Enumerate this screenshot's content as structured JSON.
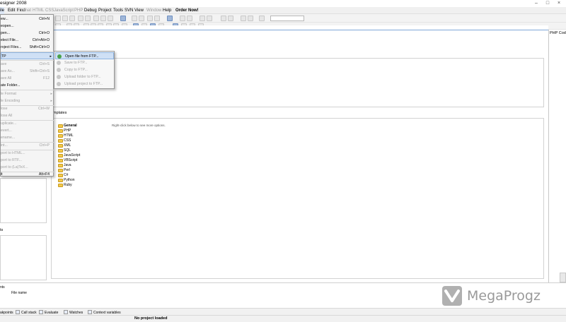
{
  "window": {
    "title": "esigner 2008",
    "controls": [
      "–",
      "□",
      "×"
    ]
  },
  "menubar": {
    "items": [
      {
        "label": "ile",
        "state": "active"
      },
      {
        "label": "Edit",
        "state": "normal"
      },
      {
        "label": "Find",
        "state": "normal"
      },
      {
        "label": "Format",
        "state": "disabled"
      },
      {
        "label": "HTML",
        "state": "disabled"
      },
      {
        "label": "CSS",
        "state": "disabled"
      },
      {
        "label": "JavaScript",
        "state": "disabled"
      },
      {
        "label": "PHP",
        "state": "disabled"
      },
      {
        "label": "Debug",
        "state": "normal"
      },
      {
        "label": "Project",
        "state": "normal"
      },
      {
        "label": "Tools",
        "state": "normal"
      },
      {
        "label": "SVN",
        "state": "normal"
      },
      {
        "label": "View",
        "state": "normal"
      },
      {
        "label": "Window",
        "state": "disabled"
      },
      {
        "label": "Help",
        "state": "normal"
      },
      {
        "label": "Order Now!",
        "state": "bold"
      }
    ]
  },
  "file_menu": {
    "items": [
      {
        "label": "ew...",
        "shortcut": "Ctrl+N",
        "disabled": false
      },
      {
        "label": "eopen...",
        "shortcut": "",
        "disabled": false
      },
      {
        "label": "pen...",
        "shortcut": "Ctrl+O",
        "disabled": false
      },
      {
        "label": "elect File...",
        "shortcut": "Ctrl+Alt+O",
        "disabled": false
      },
      {
        "label": "roject Files...",
        "shortcut": "Shift+Ctrl+O",
        "disabled": false
      },
      {
        "label": "TP",
        "shortcut": "",
        "disabled": false,
        "submenu": true,
        "highlighted": true
      },
      {
        "label": "ave",
        "shortcut": "Ctrl+S",
        "disabled": true
      },
      {
        "label": "ave As...",
        "shortcut": "Shift+Ctrl+S",
        "disabled": true
      },
      {
        "label": "ave All",
        "shortcut": "F12",
        "disabled": true
      },
      {
        "label": "ate Folder...",
        "shortcut": "",
        "disabled": false
      },
      {
        "label": "le Format",
        "shortcut": "",
        "disabled": true,
        "submenu": true
      },
      {
        "label": "le Encoding",
        "shortcut": "",
        "disabled": true,
        "submenu": true
      },
      {
        "label": "lose",
        "shortcut": "Ctrl+W",
        "disabled": true
      },
      {
        "label": "lose All",
        "shortcut": "",
        "disabled": true
      },
      {
        "label": "uplicate...",
        "shortcut": "",
        "disabled": true
      },
      {
        "label": "evert...",
        "shortcut": "",
        "disabled": true
      },
      {
        "label": "ename...",
        "shortcut": "",
        "disabled": true
      },
      {
        "label": "int...",
        "shortcut": "Ctrl+P",
        "disabled": true
      },
      {
        "label": "port to HTML...",
        "shortcut": "",
        "disabled": true
      },
      {
        "label": "port to RTF...",
        "shortcut": "",
        "disabled": true
      },
      {
        "label": "port to (La)TeX...",
        "shortcut": "",
        "disabled": true
      },
      {
        "label": "it",
        "shortcut": "Alt+F4",
        "disabled": false
      }
    ]
  },
  "ftp_submenu": {
    "items": [
      {
        "label": "Open file from FTP...",
        "highlighted": true,
        "disabled": false
      },
      {
        "label": "Save to FTP...",
        "disabled": true
      },
      {
        "label": "Copy to FTP...",
        "disabled": true
      },
      {
        "label": "Upload folder to FTP...",
        "disabled": true
      },
      {
        "label": "Upload project to FTP...",
        "disabled": true
      }
    ]
  },
  "start_page": {
    "templates_title": "emplates",
    "templates_hint": "Right-click below to see more options.",
    "templates": [
      {
        "label": "General",
        "bold": true
      },
      {
        "label": "PHP"
      },
      {
        "label": "HTML"
      },
      {
        "label": "CSS"
      },
      {
        "label": "XML"
      },
      {
        "label": "SQL"
      },
      {
        "label": "JavaScript"
      },
      {
        "label": "VBScript"
      },
      {
        "label": "Java"
      },
      {
        "label": "Perl"
      },
      {
        "label": "C#"
      },
      {
        "label": "Python"
      },
      {
        "label": "Ruby"
      }
    ],
    "lower_left_title": "ts"
  },
  "right_panel": {
    "title": "PHP Cod"
  },
  "bottom_panel": {
    "title": "nts",
    "column_header": "File name",
    "tabs": [
      {
        "label": "akpoints",
        "icon": "breakpoint-icon"
      },
      {
        "label": "Call stack",
        "icon": "call-stack-icon"
      },
      {
        "label": "Evaluate",
        "icon": "evaluate-icon"
      },
      {
        "label": "Watches",
        "icon": "watches-icon"
      },
      {
        "label": "Context variables",
        "icon": "context-variables-icon"
      }
    ]
  },
  "status": {
    "text": "No project loaded"
  },
  "watermark": {
    "text": "MegaProgz"
  },
  "colors": {
    "highlight": "#cfe0f5",
    "folder": "#f2c94c",
    "accent_line": "#7fa7d8"
  }
}
